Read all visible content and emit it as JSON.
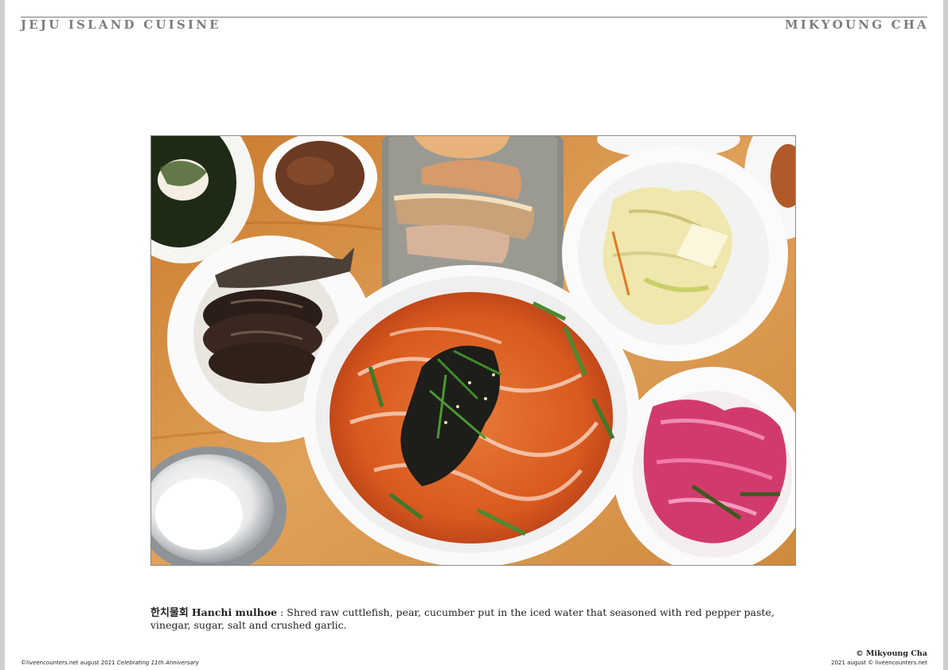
{
  "header": {
    "left_title": "JEJU ISLAND CUISINE",
    "right_title": "MIKYOUNG CHA"
  },
  "photo": {
    "icons": [
      "noodle-bowl-icon",
      "fish-dish-icon",
      "pork-plate-icon",
      "kimchi-dish-icon",
      "pickled-onion-dish-icon"
    ],
    "colors": {
      "table": "#d7913f",
      "broth": "#e0662a",
      "bowl": "#fafafa",
      "slate": "#8c8c86",
      "cabbage": "#f3eab0",
      "onion": "#d23a6e"
    }
  },
  "caption": {
    "korean": "한치물회",
    "name": "Hanchi mulhoe",
    "separator": " : ",
    "text": "Shred raw cuttlefish, pear, cucumber put in the iced water that seasoned with red pepper paste, vinegar, sugar, salt and crushed garlic."
  },
  "footer": {
    "left_main": "©liveencounters.net august 2021",
    "left_italic": "Celebrating 11th Anniversary",
    "right_credit": "© Mikyoung Cha",
    "right_line": "2021 august © liveencounters.net"
  }
}
